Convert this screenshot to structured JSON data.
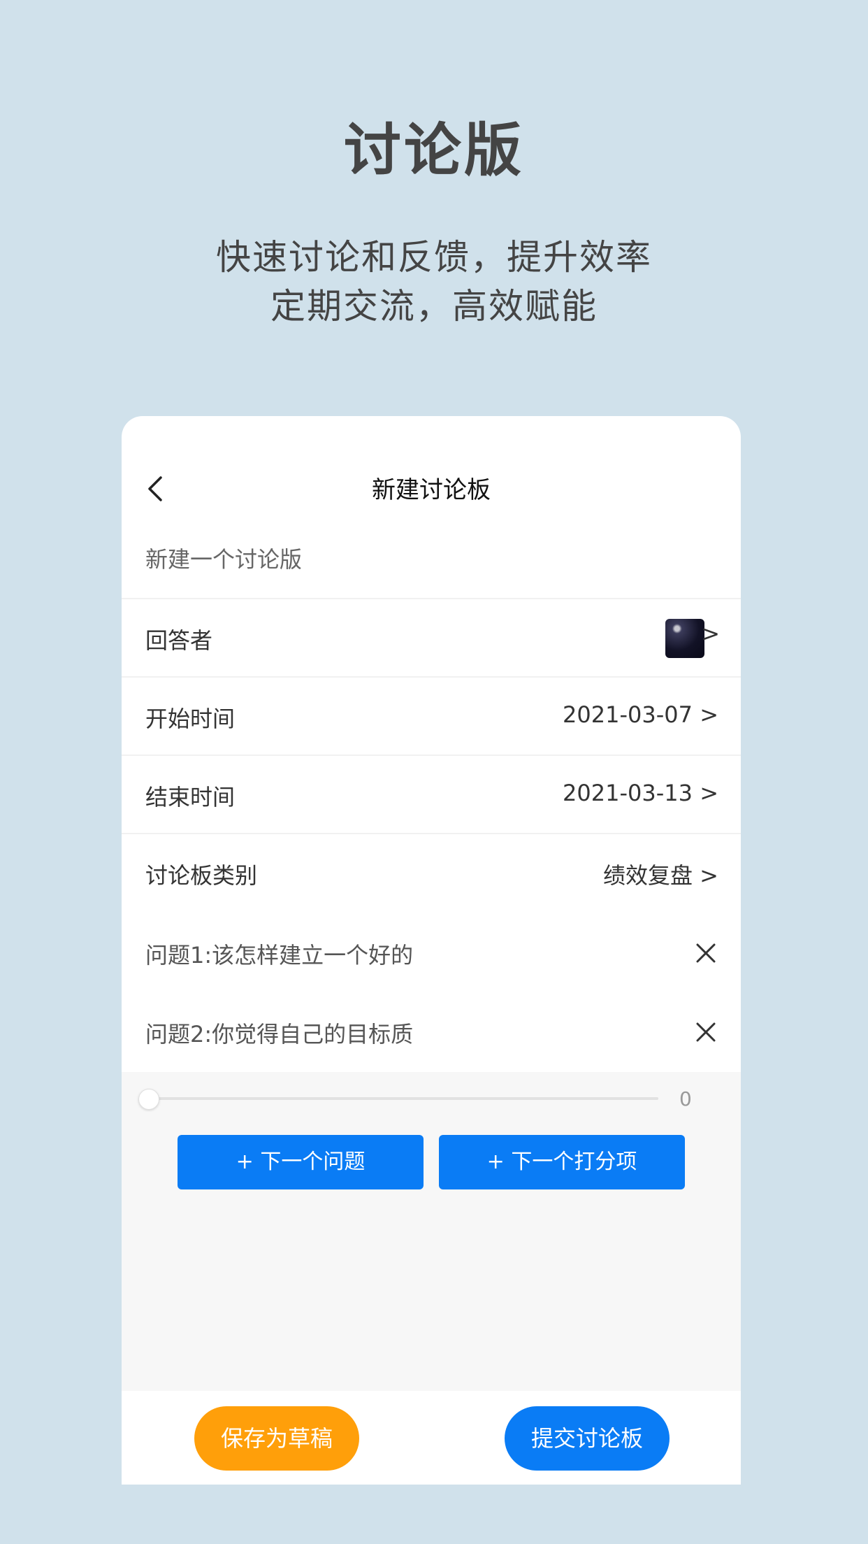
{
  "hero": {
    "title": "讨论版",
    "subtitle_line1": "快速讨论和反馈，提升效率",
    "subtitle_line2": "定期交流，高效赋能"
  },
  "nav": {
    "title": "新建讨论板"
  },
  "form": {
    "subject": "新建一个讨论版",
    "respondent_label": "回答者",
    "respondent_chevron": ">",
    "start_label": "开始时间",
    "start_value": "2021-03-07 >",
    "end_label": "结束时间",
    "end_value": "2021-03-13 >",
    "category_label": "讨论板类别",
    "category_value": "绩效复盘 >",
    "questions": [
      {
        "text": "问题1:该怎样建立一个好的"
      },
      {
        "text": "问题2:你觉得自己的目标质"
      }
    ],
    "score_value": "0"
  },
  "actions": {
    "next_question": "+ 下一个问题",
    "next_score": "+ 下一个打分项",
    "save_draft": "保存为草稿",
    "submit": "提交讨论板"
  },
  "colors": {
    "background": "#d0e1eb",
    "primary_blue": "#0a7cf5",
    "draft_orange": "#ff9f0a"
  }
}
